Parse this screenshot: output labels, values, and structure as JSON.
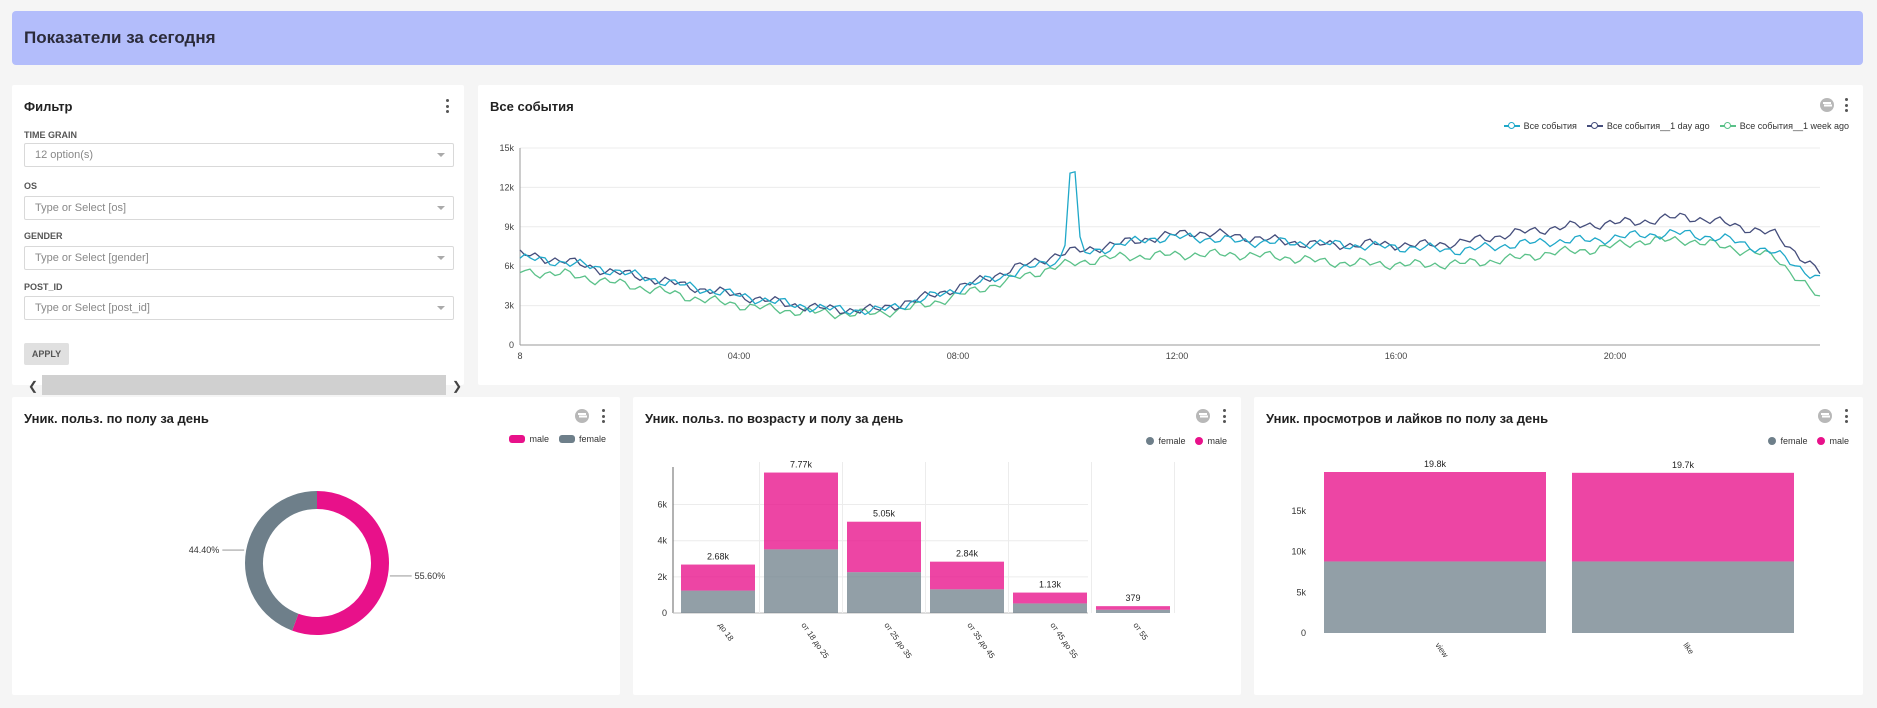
{
  "header": {
    "title": "Показатели за сегодня"
  },
  "filter": {
    "title": "Фильтр",
    "fields": [
      {
        "label": "TIME GRAIN",
        "value": "12 option(s)"
      },
      {
        "label": "OS",
        "placeholder": "Type or Select [os]"
      },
      {
        "label": "GENDER",
        "placeholder": "Type or Select [gender]"
      },
      {
        "label": "POST_ID",
        "placeholder": "Type or Select [post_id]"
      }
    ],
    "apply_label": "APPLY"
  },
  "events": {
    "title": "Все события",
    "legend": [
      "Все события",
      "Все события__1 day ago",
      "Все события__1 week ago"
    ],
    "colors": [
      "#1fa8c9",
      "#454e7c",
      "#5ac189"
    ]
  },
  "gender": {
    "title": "Уник. польз. по полу за день",
    "legend": [
      "male",
      "female"
    ],
    "labels": [
      "55.60%",
      "44.40%"
    ]
  },
  "age": {
    "title": "Уник. польз. по возрасту и полу за день",
    "legend": [
      "female",
      "male"
    ]
  },
  "views": {
    "title": "Уник. просмотров и лайков по полу за день",
    "legend": [
      "female",
      "male"
    ]
  },
  "colors": {
    "male": "#e8118a",
    "female": "#6e7f8a",
    "accent": "#b3bdfb"
  },
  "chart_data": [
    {
      "type": "line",
      "title": "Все события",
      "x_ticks": [
        "8",
        "04:00",
        "08:00",
        "12:00",
        "16:00",
        "20:00"
      ],
      "y_ticks": [
        "0",
        "3k",
        "6k",
        "9k",
        "12k",
        "15k"
      ],
      "ylim": [
        0,
        15000
      ],
      "series": [
        {
          "name": "Все события",
          "values": [
            6600,
            6300,
            5700,
            5000,
            4300,
            3700,
            3100,
            2700,
            2600,
            3500,
            4500,
            5500,
            6500,
            7300,
            8100,
            8200,
            7900,
            7800,
            7700,
            7500,
            7400,
            7200,
            7600,
            7900,
            8000,
            8400,
            8500,
            8000,
            7000,
            5000
          ]
        },
        {
          "name": "Все события__1 day ago",
          "values": [
            6900,
            6400,
            5600,
            5000,
            4300,
            3700,
            3100,
            2700,
            2700,
            3600,
            4600,
            5800,
            6900,
            7500,
            8100,
            8600,
            8300,
            7900,
            7600,
            7700,
            7600,
            7800,
            8400,
            8900,
            9200,
            9400,
            9800,
            9200,
            8400,
            5500
          ]
        },
        {
          "name": "Все события__1 week ago",
          "values": [
            5600,
            5400,
            4800,
            4200,
            3500,
            3000,
            2600,
            2400,
            2400,
            3000,
            4000,
            5000,
            6000,
            6600,
            6800,
            6900,
            6900,
            6700,
            6300,
            6200,
            6100,
            6200,
            6500,
            7000,
            7300,
            7900,
            8000,
            7400,
            6700,
            3500
          ]
        }
      ],
      "spike": {
        "series": "Все события",
        "x_position": 0.425,
        "value": 14800
      }
    },
    {
      "type": "pie",
      "title": "Уник. польз. по полу за день",
      "categories": [
        "male",
        "female"
      ],
      "values": [
        55.6,
        44.4
      ]
    },
    {
      "type": "bar",
      "stacked": true,
      "title": "Уник. польз. по возрасту и полу за день",
      "categories": [
        "до 18",
        "от 18 до 25",
        "от 25 до 35",
        "от 35 до 45",
        "от 45 до 55",
        "от 55"
      ],
      "totals": [
        "2.68k",
        "7.77k",
        "5.05k",
        "2.84k",
        "1.13k",
        "379"
      ],
      "y_ticks": [
        "0",
        "2k",
        "4k",
        "6k"
      ],
      "ylim": [
        0,
        7800
      ],
      "series": [
        {
          "name": "female",
          "values": [
            1240,
            3520,
            2260,
            1310,
            530,
            180
          ]
        },
        {
          "name": "male",
          "values": [
            1440,
            4250,
            2790,
            1530,
            600,
            199
          ]
        }
      ]
    },
    {
      "type": "bar",
      "stacked": true,
      "title": "Уник. просмотров и лайков по полу за день",
      "categories": [
        "view",
        "like"
      ],
      "totals": [
        "19.8k",
        "19.7k"
      ],
      "y_ticks": [
        "0",
        "5k",
        "10k",
        "15k"
      ],
      "ylim": [
        0,
        19800
      ],
      "series": [
        {
          "name": "female",
          "values": [
            8800,
            8800
          ]
        },
        {
          "name": "male",
          "values": [
            11000,
            10900
          ]
        }
      ]
    }
  ]
}
